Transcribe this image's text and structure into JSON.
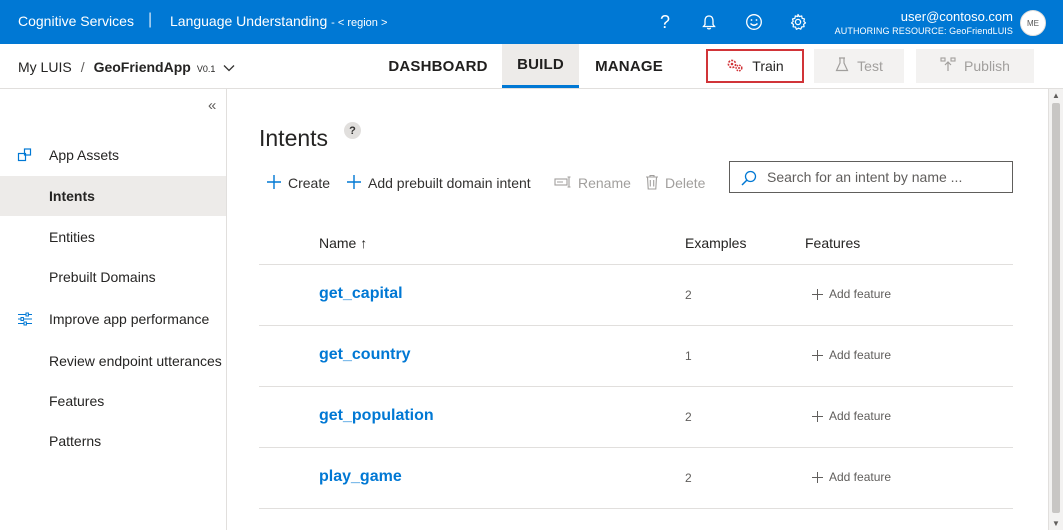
{
  "topbar": {
    "brand": "Cognitive Services",
    "separator": "|",
    "product": "Language Understanding",
    "region": "- < region >",
    "help_glyph": "?",
    "user_email": "user@contoso.com",
    "authoring_resource": "AUTHORING RESOURCE: GeoFriendLUIS",
    "avatar_initials": "ME",
    "icons": [
      "help-icon",
      "bell-icon",
      "smiley-icon",
      "gear-icon"
    ]
  },
  "subbar": {
    "my_luis": "My LUIS",
    "slash": "/",
    "app_name": "GeoFriendApp",
    "version": "V0.1",
    "tabs": [
      {
        "label": "DASHBOARD",
        "active": false
      },
      {
        "label": "BUILD",
        "active": true
      },
      {
        "label": "MANAGE",
        "active": false
      }
    ],
    "train_label": "Train",
    "test_label": "Test",
    "publish_label": "Publish"
  },
  "sidebar": {
    "collapse_glyph": "«",
    "items": [
      {
        "label": "App Assets",
        "icon": "assets-icon",
        "active": false
      },
      {
        "label": "Intents",
        "icon": "",
        "active": true
      },
      {
        "label": "Entities",
        "icon": "",
        "active": false
      },
      {
        "label": "Prebuilt Domains",
        "icon": "",
        "active": false
      },
      {
        "label": "Improve app performance",
        "icon": "sliders-icon",
        "active": false
      },
      {
        "label": "Review endpoint utterances",
        "icon": "",
        "active": false
      },
      {
        "label": "Features",
        "icon": "",
        "active": false
      },
      {
        "label": "Patterns",
        "icon": "",
        "active": false
      }
    ]
  },
  "main": {
    "title": "Intents",
    "help_glyph": "?",
    "commands": {
      "create": "Create",
      "add_prebuilt": "Add prebuilt domain intent",
      "rename": "Rename",
      "delete": "Delete"
    },
    "search_placeholder": "Search for an intent by name ...",
    "columns": {
      "name": "Name ↑",
      "examples": "Examples",
      "features": "Features"
    },
    "add_feature_label": "Add feature",
    "rows": [
      {
        "name": "get_capital",
        "examples": "2"
      },
      {
        "name": "get_country",
        "examples": "1"
      },
      {
        "name": "get_population",
        "examples": "2"
      },
      {
        "name": "play_game",
        "examples": "2"
      }
    ]
  },
  "colors": {
    "brand_blue": "#0078d4",
    "train_highlight": "#d13438",
    "link_blue": "#0078d4"
  }
}
